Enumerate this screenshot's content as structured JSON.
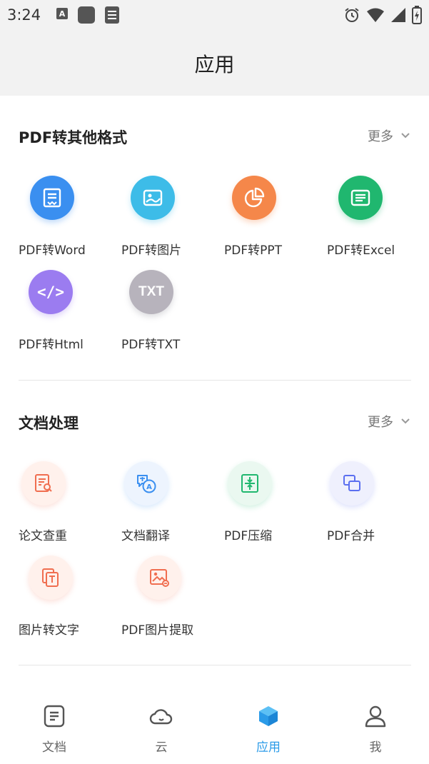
{
  "status_bar": {
    "time": "3:24"
  },
  "app_bar": {
    "title": "应用"
  },
  "sections": [
    {
      "title": "PDF转其他格式",
      "more": "更多",
      "items": [
        {
          "label": "PDF转Word",
          "icon": "word-icon",
          "color": "#3a8ff0"
        },
        {
          "label": "PDF转图片",
          "icon": "image-icon",
          "color": "#3dbce8"
        },
        {
          "label": "PDF转PPT",
          "icon": "pie-chart-icon",
          "color": "#f5874a"
        },
        {
          "label": "PDF转Excel",
          "icon": "sheet-icon",
          "color": "#20b76f"
        },
        {
          "label": "PDF转Html",
          "icon": "code-icon",
          "color": "#9b7cf0",
          "glyph": "</>"
        },
        {
          "label": "PDF转TXT",
          "icon": "txt-icon",
          "color": "#b7b3bc",
          "glyph": "TXT"
        }
      ]
    },
    {
      "title": "文档处理",
      "more": "更多",
      "items": [
        {
          "label": "论文查重",
          "icon": "paper-check-icon",
          "color": "#f06e50",
          "bg": "#fff1ec"
        },
        {
          "label": "文档翻译",
          "icon": "translate-icon",
          "color": "#3a8ff0",
          "bg": "#edf4fe"
        },
        {
          "label": "PDF压缩",
          "icon": "compress-icon",
          "color": "#20b76f",
          "bg": "#eaf8f0"
        },
        {
          "label": "PDF合并",
          "icon": "merge-icon",
          "color": "#5b6ff0",
          "bg": "#eff0fd"
        },
        {
          "label": "图片转文字",
          "icon": "image-to-text-icon",
          "color": "#f06e50",
          "bg": "#fff1ec"
        },
        {
          "label": "PDF图片提取",
          "icon": "image-extract-icon",
          "color": "#f06e50",
          "bg": "#fff1ec"
        }
      ]
    }
  ],
  "bottom_nav": [
    {
      "label": "文档",
      "icon": "document-icon"
    },
    {
      "label": "云",
      "icon": "cloud-icon"
    },
    {
      "label": "应用",
      "icon": "cube-icon",
      "active": true
    },
    {
      "label": "我",
      "icon": "person-icon"
    }
  ],
  "colors": {
    "accent": "#2b9be8",
    "header_bg": "#f2f2f2"
  }
}
